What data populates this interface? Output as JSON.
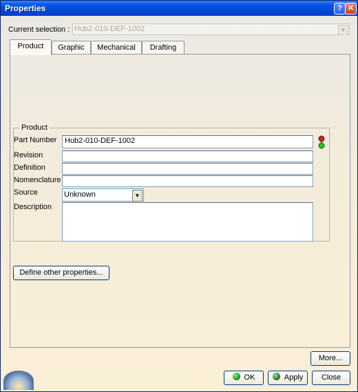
{
  "window": {
    "title": "Properties",
    "help_glyph": "?",
    "close_glyph": "✕"
  },
  "selection": {
    "label": "Current selection :",
    "value": "Hub2-010-DEF-1002"
  },
  "tabs": [
    {
      "label": "Product"
    },
    {
      "label": "Graphic"
    },
    {
      "label": "Mechanical"
    },
    {
      "label": "Drafting"
    }
  ],
  "product_group": {
    "title": "Product",
    "part_number_label": "Part Number",
    "part_number_value": "Hub2-010-DEF-1002",
    "revision_label": "Revision",
    "revision_value": "",
    "definition_label": "Definition",
    "definition_value": "",
    "nomenclature_label": "Nomenclature",
    "nomenclature_value": "",
    "source_label": "Source",
    "source_value": "Unknown",
    "description_label": "Description",
    "description_value": ""
  },
  "buttons": {
    "define_other": "Define other properties...",
    "more": "More...",
    "ok": "OK",
    "apply": "Apply",
    "close": "Close"
  },
  "colors": {
    "title_bar": "#0054e3",
    "ok_icon": "#1aa31a",
    "apply_icon": "#2d8a2d"
  }
}
